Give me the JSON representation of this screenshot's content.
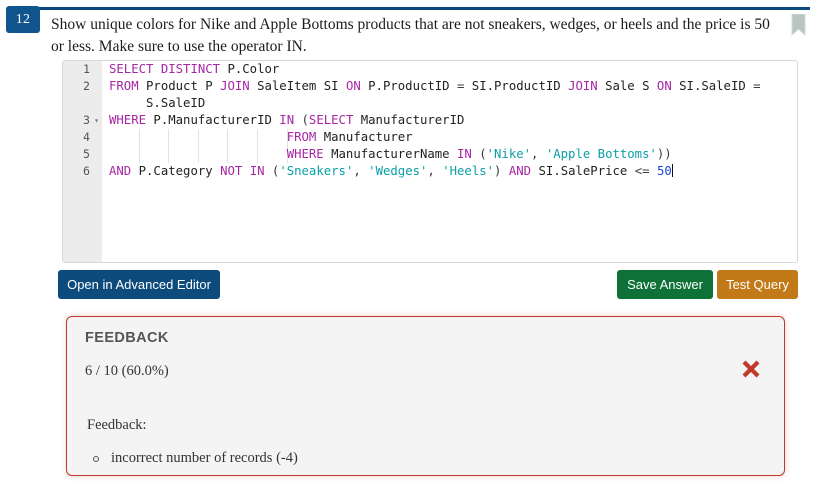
{
  "question": {
    "number": "12",
    "prompt": "Show unique colors for Nike and Apple Bottoms products that are not sneakers, wedges, or heels and the price is 50 or less. Make sure to use the operator IN.",
    "bookmark_icon": "bookmark-icon"
  },
  "editor": {
    "lines": [
      {
        "number": "1",
        "foldable": false,
        "active": false,
        "tokens": [
          {
            "t": "SELECT",
            "c": "kw"
          },
          {
            "t": " ",
            "c": "op"
          },
          {
            "t": "DISTINCT",
            "c": "kw"
          },
          {
            "t": " P.Color",
            "c": "idf"
          }
        ]
      },
      {
        "number": "2",
        "foldable": false,
        "active": false,
        "tokens": [
          {
            "t": "FROM",
            "c": "kw"
          },
          {
            "t": " Product P ",
            "c": "idf"
          },
          {
            "t": "JOIN",
            "c": "kw"
          },
          {
            "t": " SaleItem SI ",
            "c": "idf"
          },
          {
            "t": "ON",
            "c": "kw"
          },
          {
            "t": " P.ProductID ",
            "c": "idf"
          },
          {
            "t": "=",
            "c": "op"
          },
          {
            "t": " SI.ProductID ",
            "c": "idf"
          },
          {
            "t": "JOIN",
            "c": "kw"
          },
          {
            "t": " Sale S ",
            "c": "idf"
          },
          {
            "t": "ON",
            "c": "kw"
          },
          {
            "t": " SI.SaleID ",
            "c": "idf"
          },
          {
            "t": "=",
            "c": "op"
          }
        ]
      },
      {
        "number": "",
        "foldable": false,
        "active": false,
        "wrapped": true,
        "tokens": [
          {
            "t": "     S.SaleID",
            "c": "idf"
          }
        ]
      },
      {
        "number": "3",
        "foldable": true,
        "active": false,
        "tokens": [
          {
            "t": "WHERE",
            "c": "kw"
          },
          {
            "t": " P.ManufacturerID ",
            "c": "idf"
          },
          {
            "t": "IN",
            "c": "kw"
          },
          {
            "t": " (",
            "c": "op"
          },
          {
            "t": "SELECT",
            "c": "kw"
          },
          {
            "t": " ManufacturerID",
            "c": "idf"
          }
        ]
      },
      {
        "number": "4",
        "foldable": false,
        "active": false,
        "tokens": [
          {
            "t": "                        ",
            "c": "idf"
          },
          {
            "t": "FROM",
            "c": "kw"
          },
          {
            "t": " Manufacturer",
            "c": "idf"
          }
        ]
      },
      {
        "number": "5",
        "foldable": false,
        "active": false,
        "tokens": [
          {
            "t": "                        ",
            "c": "idf"
          },
          {
            "t": "WHERE",
            "c": "kw"
          },
          {
            "t": " ManufacturerName ",
            "c": "idf"
          },
          {
            "t": "IN",
            "c": "kw"
          },
          {
            "t": " (",
            "c": "op"
          },
          {
            "t": "'Nike'",
            "c": "str"
          },
          {
            "t": ", ",
            "c": "op"
          },
          {
            "t": "'Apple Bottoms'",
            "c": "str"
          },
          {
            "t": "))",
            "c": "op"
          }
        ]
      },
      {
        "number": "6",
        "foldable": false,
        "active": true,
        "caret": true,
        "tokens": [
          {
            "t": "AND",
            "c": "kw"
          },
          {
            "t": " P.Category ",
            "c": "idf"
          },
          {
            "t": "NOT",
            "c": "kw"
          },
          {
            "t": " ",
            "c": "op"
          },
          {
            "t": "IN",
            "c": "kw"
          },
          {
            "t": " (",
            "c": "op"
          },
          {
            "t": "'Sneakers'",
            "c": "str"
          },
          {
            "t": ", ",
            "c": "op"
          },
          {
            "t": "'Wedges'",
            "c": "str"
          },
          {
            "t": ", ",
            "c": "op"
          },
          {
            "t": "'Heels'",
            "c": "str"
          },
          {
            "t": ") ",
            "c": "op"
          },
          {
            "t": "AND",
            "c": "kw"
          },
          {
            "t": " SI.SalePrice ",
            "c": "idf"
          },
          {
            "t": "<=",
            "c": "op"
          },
          {
            "t": " ",
            "c": "op"
          },
          {
            "t": "50",
            "c": "num"
          }
        ]
      }
    ]
  },
  "buttons": {
    "advanced_editor": "Open in Advanced Editor",
    "save_answer": "Save Answer",
    "test_query": "Test Query"
  },
  "feedback": {
    "title": "FEEDBACK",
    "score": "6 / 10  (60.0%)",
    "status_icon": "x-mark-icon",
    "label": "Feedback:",
    "items": [
      "incorrect number of records (-4)"
    ]
  },
  "colors": {
    "badge": "#10558d",
    "top_rule": "#0a4a80",
    "advanced_button": "#0d4b7c",
    "save_button": "#0e7138",
    "test_button": "#c27a18",
    "feedback_border": "#c0392b",
    "x_mark": "#c0392b"
  }
}
